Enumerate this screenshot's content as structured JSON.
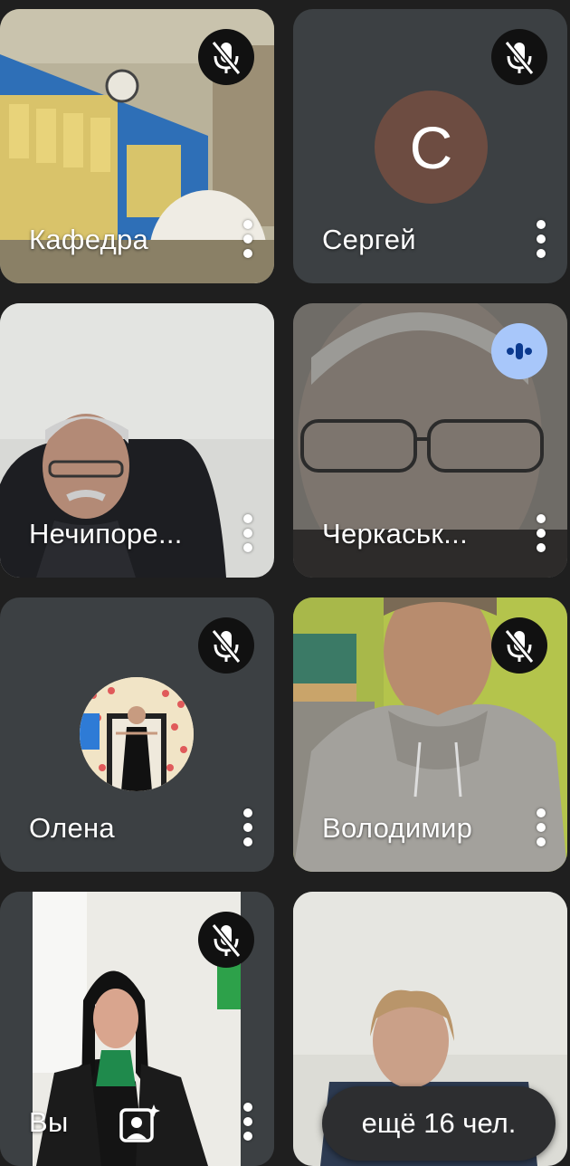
{
  "participants": [
    {
      "name": "Кафедра",
      "mic": "muted"
    },
    {
      "name": "Сергей",
      "mic": "muted",
      "avatar_letter": "С",
      "avatar_color": "#6d4c41"
    },
    {
      "name": "Нечипоре...",
      "mic": "on"
    },
    {
      "name": "Черкаськ...",
      "mic": "speaking"
    },
    {
      "name": "Олена",
      "mic": "muted"
    },
    {
      "name": "Володимир",
      "mic": "muted"
    },
    {
      "name": "Вы",
      "mic": "muted"
    },
    {
      "name": "",
      "mic": "on"
    }
  ],
  "overflow_label": "ещё 16 чел.",
  "icons": {
    "mic_off": "mic-off-icon",
    "more": "more-vert-icon",
    "speaking": "audio-level-icon",
    "effects": "visual-effects-icon"
  },
  "colors": {
    "background": "#1f1f1f",
    "tile": "#3c4043",
    "speaking_indicator": "#a8c7fa"
  }
}
